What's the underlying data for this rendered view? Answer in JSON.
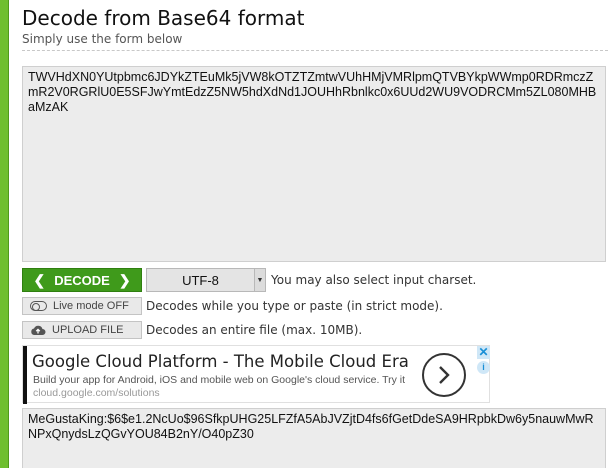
{
  "header": {
    "title": "Decode from Base64 format",
    "subtitle": "Simply use the form below"
  },
  "input": {
    "value": "TWVHdXN0YUtpbmc6JDYkZTEuMk5jVW8kOTZTZmtwVUhHMjVMRlpmQTVBYkpWWmp0RDRmczZmR2V0RGRlU0E5SFJwYmtEdzZ5NW5hdXdNd1JOUHhRbnlkc0x6UUd2WU9VODRCMm5ZL080MHBaMzAK"
  },
  "controls": {
    "decode_label": "DECODE",
    "charset_value": "UTF-8",
    "charset_hint": "You may also select input charset.",
    "live_mode_label": "Live mode OFF",
    "live_mode_hint": "Decodes while you type or paste (in strict mode).",
    "upload_label": "UPLOAD FILE",
    "upload_hint": "Decodes an entire file (max. 10MB)."
  },
  "ad": {
    "title": "Google Cloud Platform - The Mobile Cloud Era",
    "body": "Build your app for Android, iOS and mobile web on Google's cloud service. Try it",
    "url": "cloud.google.com/solutions",
    "close_glyph": "✕",
    "info_glyph": "i"
  },
  "output": {
    "value": "MeGustaKing:$6$e1.2NcUo$96SfkpUHG25LFZfA5AbJVZjtD4fs6fGetDdeSA9HRpbkDw6y5nauwMwRNPxQnydsLzQGvYOU84B2nY/O40pZ30"
  },
  "colors": {
    "accent_green": "#3f9a1b",
    "stripe_green": "#6fbf2f",
    "ad_blue": "#1a8fd6"
  },
  "icons": {
    "decode_left": "chevron-left-icon",
    "decode_right": "chevron-right-icon",
    "live_toggle": "toggle-icon",
    "upload": "cloud-upload-icon",
    "ad_arrow": "arrow-right-circle-icon",
    "ad_close": "close-icon",
    "ad_info": "info-icon"
  }
}
